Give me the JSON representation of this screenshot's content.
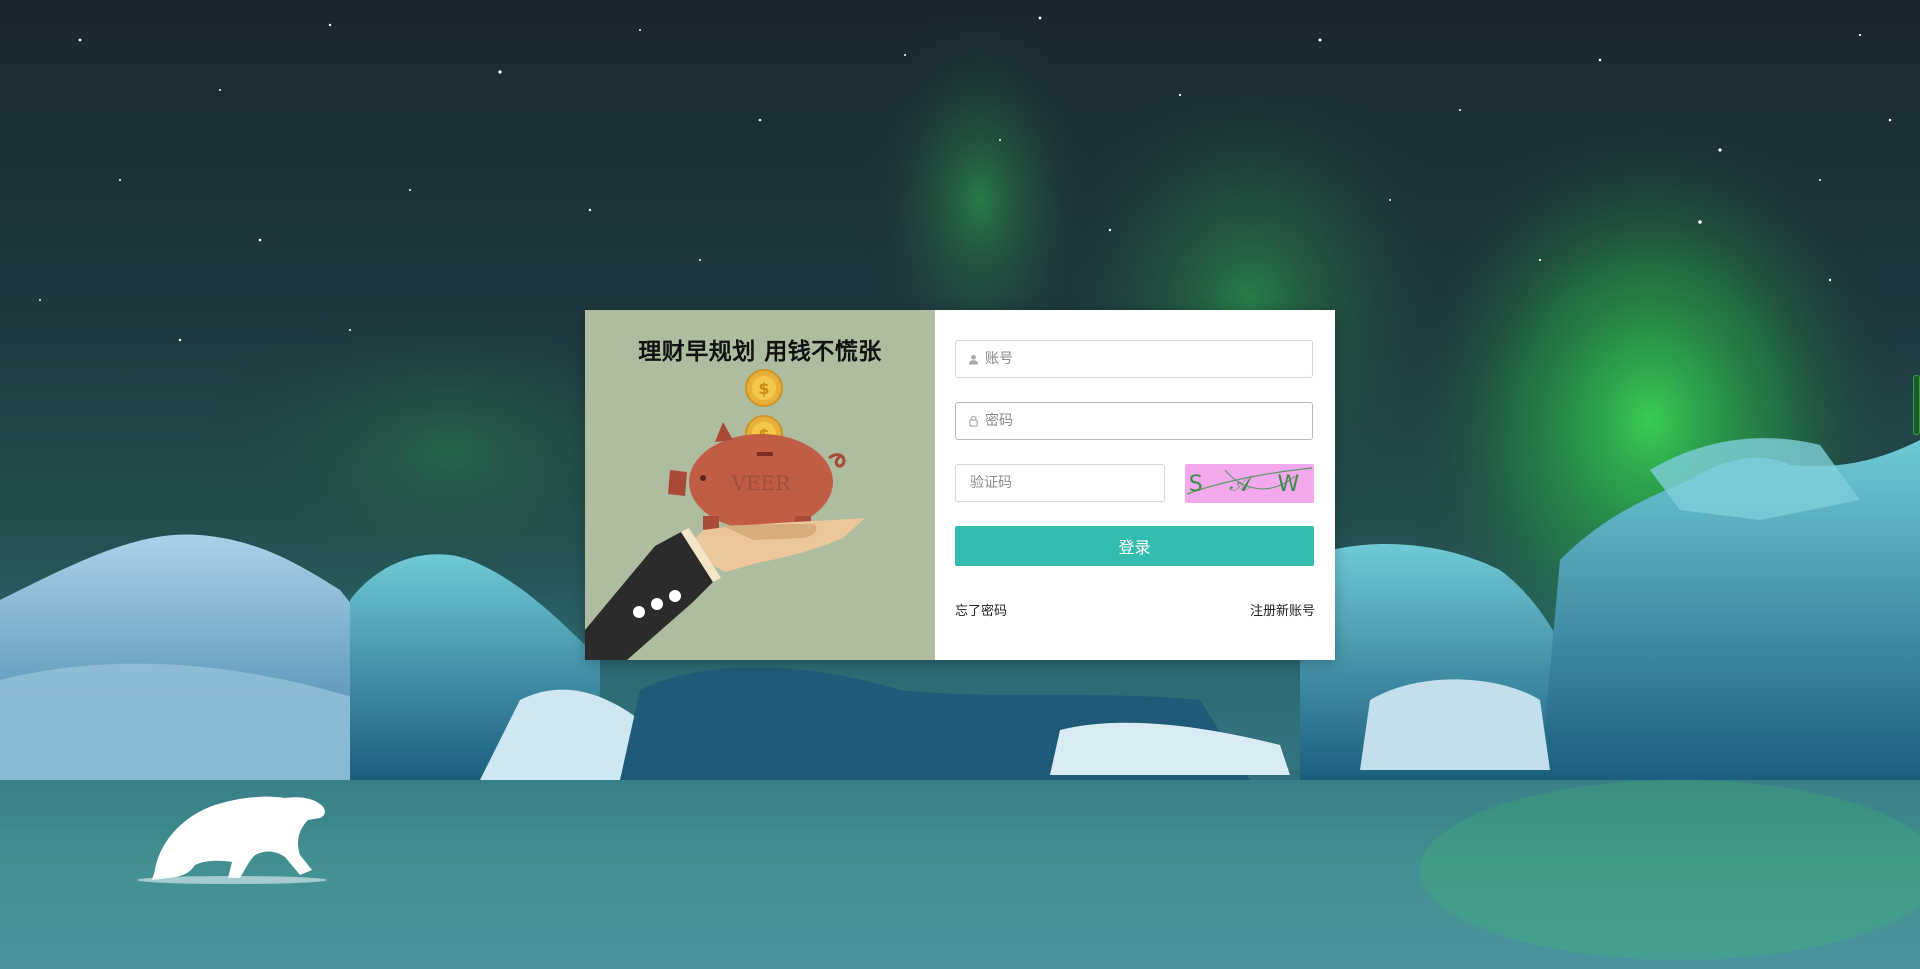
{
  "promo": {
    "title": "理财早规划 用钱不慌张",
    "image_watermark": "VEER"
  },
  "form": {
    "account_placeholder": "账号",
    "password_placeholder": "密码",
    "captcha_placeholder": "验证码",
    "captcha_text": "S 𝒜 W",
    "login_label": "登录",
    "forgot_label": "忘了密码",
    "register_label": "注册新账号"
  },
  "icons": {
    "account": "user-icon",
    "password": "lock-icon"
  },
  "colors": {
    "login_button": "#34bcae",
    "promo_background": "#aebca0",
    "captcha_background": "#f4a8ee",
    "card_background": "#ffffff"
  }
}
